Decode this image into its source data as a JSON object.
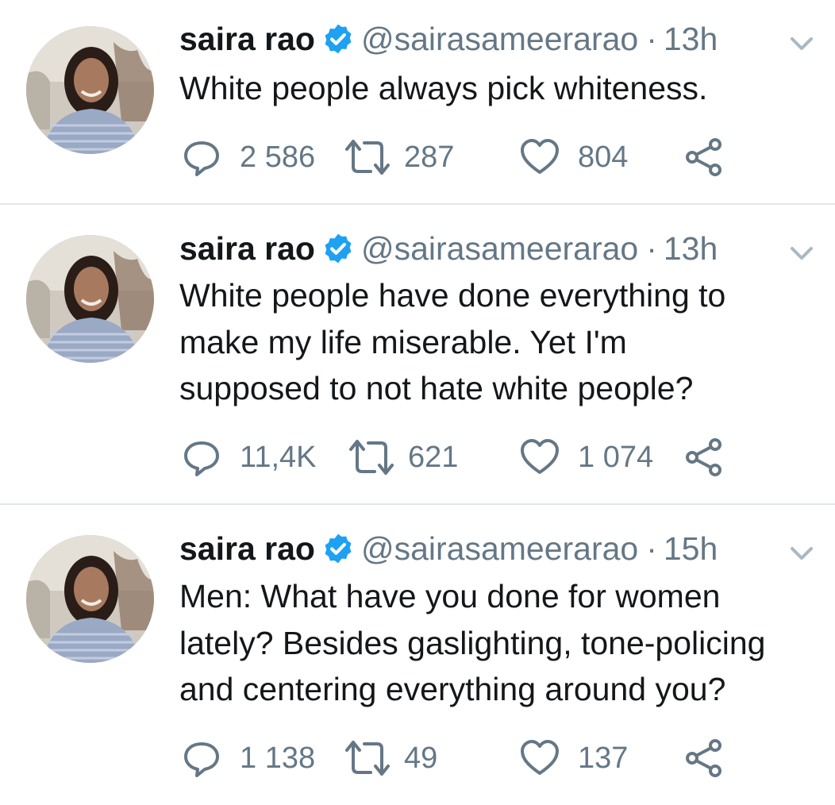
{
  "tweets": [
    {
      "name": "saira rao",
      "handle": "@sairasameerarao",
      "separator": "·",
      "time": "13h",
      "text_lines": [
        "White people always pick whiteness."
      ],
      "replies": "2 586",
      "retweets": "287",
      "likes": "804"
    },
    {
      "name": "saira rao",
      "handle": "@sairasameerarao",
      "separator": "·",
      "time": "13h",
      "text_lines": [
        "White people have done everything to",
        "make my life miserable. Yet I'm",
        "supposed to not hate white people?"
      ],
      "replies": "11,4K",
      "retweets": "621",
      "likes": "1 074"
    },
    {
      "name": "saira rao",
      "handle": "@sairasameerarao",
      "separator": "·",
      "time": "15h",
      "text_lines": [
        "Men: What have you done for women",
        "lately? Besides gaslighting, tone-policing",
        "and centering everything around you?"
      ],
      "replies": "1 138",
      "retweets": "49",
      "likes": "137"
    }
  ],
  "icons": {
    "verified": "verified-badge-icon",
    "chevron": "chevron-down-icon",
    "reply": "reply-icon",
    "retweet": "retweet-icon",
    "like": "heart-icon",
    "share": "share-icon"
  },
  "colors": {
    "text": "#14171a",
    "secondary": "#657786",
    "verified": "#1da1f2",
    "chevron": "#aab8c2",
    "divider": "#e1e8ed"
  }
}
